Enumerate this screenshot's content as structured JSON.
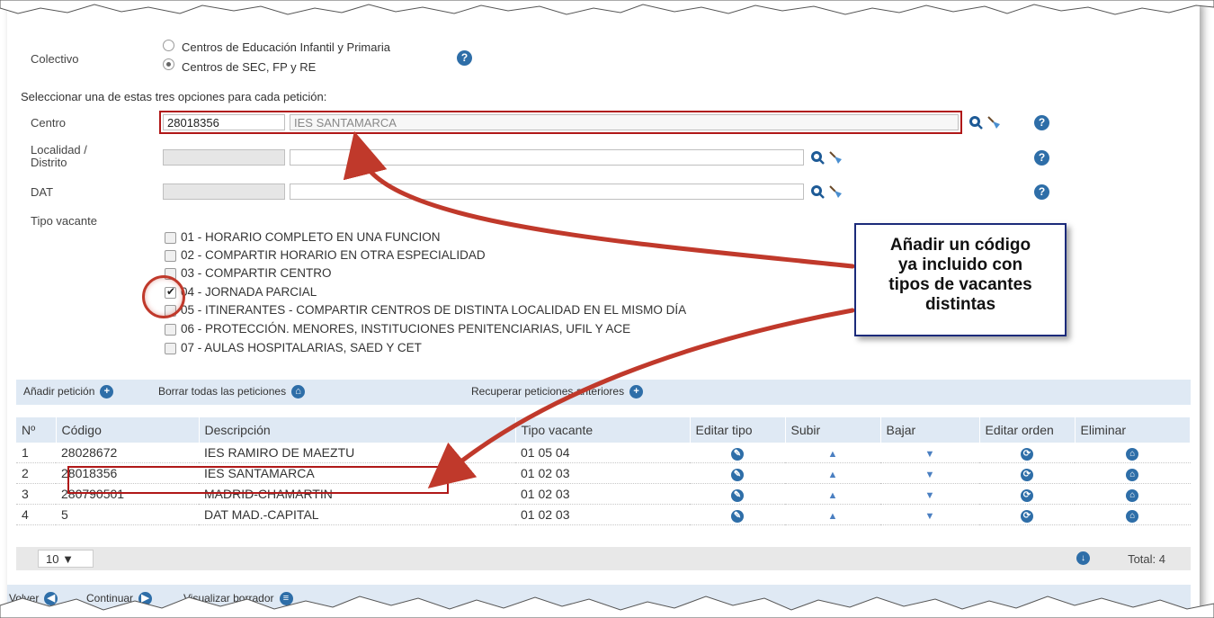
{
  "colectivo": {
    "label": "Colectivo",
    "options": [
      {
        "label": "Centros de Educación Infantil y Primaria",
        "selected": false
      },
      {
        "label": "Centros de SEC, FP y RE",
        "selected": true
      }
    ]
  },
  "instruction": "Seleccionar una de estas tres opciones para cada petición:",
  "centro": {
    "label": "Centro",
    "code": "28018356",
    "name": "IES SANTAMARCA"
  },
  "localidad": {
    "label_line1": "Localidad /",
    "label_line2": "Distrito",
    "code": "",
    "name": ""
  },
  "dat": {
    "label": "DAT",
    "code": "",
    "name": ""
  },
  "tipo_vacante": {
    "label": "Tipo vacante",
    "options": [
      {
        "label": "01 - HORARIO COMPLETO EN UNA FUNCION",
        "checked": false
      },
      {
        "label": "02 - COMPARTIR HORARIO EN OTRA ESPECIALIDAD",
        "checked": false
      },
      {
        "label": "03 - COMPARTIR CENTRO",
        "checked": false
      },
      {
        "label": "04 - JORNADA PARCIAL",
        "checked": true
      },
      {
        "label": "05 - ITINERANTES - COMPARTIR CENTROS DE DISTINTA LOCALIDAD EN EL MISMO DÍA",
        "checked": false
      },
      {
        "label": "06 - PROTECCIÓN. MENORES, INSTITUCIONES PENITENCIARIAS, UFIL Y ACE",
        "checked": false
      },
      {
        "label": "07 - AULAS HOSPITALARIAS, SAED Y CET",
        "checked": false
      }
    ]
  },
  "toolbar": {
    "add": "Añadir petición",
    "delete_all": "Borrar todas las peticiones",
    "recover": "Recuperar peticiones anteriores"
  },
  "table": {
    "headers": [
      "Nº",
      "Código",
      "Descripción",
      "Tipo vacante",
      "Editar tipo",
      "Subir",
      "Bajar",
      "Editar orden",
      "Eliminar"
    ],
    "rows": [
      {
        "n": "1",
        "codigo": "28028672",
        "descripcion": "IES RAMIRO DE MAEZTU",
        "tipo": "01 05 04"
      },
      {
        "n": "2",
        "codigo": "28018356",
        "descripcion": "IES SANTAMARCA",
        "tipo": "01 02 03"
      },
      {
        "n": "3",
        "codigo": "280790501",
        "descripcion": "MADRID-CHAMARTIN",
        "tipo": "01 02 03"
      },
      {
        "n": "4",
        "codigo": "5",
        "descripcion": "DAT MAD.-CAPITAL",
        "tipo": "01 02 03"
      }
    ]
  },
  "pager": {
    "page_size": "10 ▼",
    "total": "Total: 4"
  },
  "footer": {
    "back": "Volver",
    "continue": "Continuar",
    "preview": "Visualizar borrador"
  },
  "callout": {
    "lines": [
      "Añadir un código",
      "ya incluido con",
      "tipos de vacantes",
      "distintas"
    ]
  },
  "colors": {
    "accent": "#2e6ea8",
    "header_bg": "#dfe9f4",
    "annotation_red": "#b01818",
    "callout_border": "#1b2a7a"
  },
  "icons": [
    "help-icon",
    "search-icon",
    "broom-icon",
    "plus-icon",
    "trash-icon",
    "edit-icon",
    "arrow-up-icon",
    "arrow-down-icon",
    "reorder-icon",
    "download-icon",
    "left-arrow-icon",
    "right-arrow-icon",
    "document-icon"
  ]
}
